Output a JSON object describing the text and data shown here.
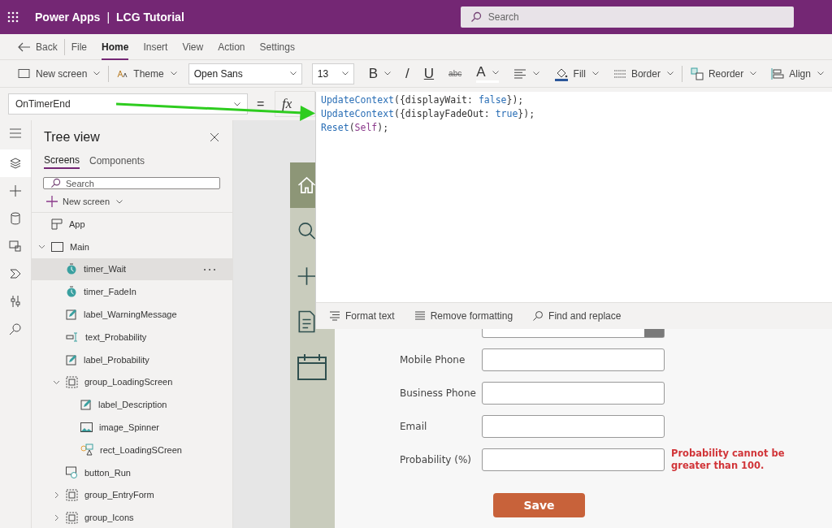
{
  "header": {
    "app_name": "Power Apps",
    "separator": "|",
    "app_title": "LCG Tutorial",
    "search": {
      "placeholder": "Search"
    }
  },
  "menu": {
    "back": "Back",
    "items": [
      {
        "label": "File",
        "selected": false
      },
      {
        "label": "Home",
        "selected": true
      },
      {
        "label": "Insert",
        "selected": false
      },
      {
        "label": "View",
        "selected": false
      },
      {
        "label": "Action",
        "selected": false
      },
      {
        "label": "Settings",
        "selected": false
      }
    ]
  },
  "toolbar": {
    "new_screen": "New screen",
    "theme": "Theme",
    "font": "Open Sans",
    "font_size": "13",
    "bold": "B",
    "italic": "/",
    "underline": "U",
    "strikethrough": "abc",
    "font_color": "A",
    "fill": "Fill",
    "border": "Border",
    "reorder": "Reorder",
    "align": "Align"
  },
  "formula_bar": {
    "property": "OnTimerEnd",
    "equals": "=",
    "fx": "fx",
    "code": [
      [
        {
          "text": "UpdateContext",
          "kind": "function"
        },
        {
          "text": "({displayWait: ",
          "kind": "plain"
        },
        {
          "text": "false",
          "kind": "literal"
        },
        {
          "text": "});",
          "kind": "plain"
        }
      ],
      [
        {
          "text": "UpdateContext",
          "kind": "function"
        },
        {
          "text": "({displayFadeOut: ",
          "kind": "plain"
        },
        {
          "text": "true",
          "kind": "literal"
        },
        {
          "text": "});",
          "kind": "plain"
        }
      ],
      [
        {
          "text": "Reset",
          "kind": "function"
        },
        {
          "text": "(",
          "kind": "plain"
        },
        {
          "text": "Self",
          "kind": "keyword"
        },
        {
          "text": ");",
          "kind": "plain"
        }
      ]
    ],
    "actions": [
      "Format text",
      "Remove formatting",
      "Find and replace"
    ]
  },
  "rail": [
    {
      "selected": true
    },
    {
      "selected": false
    },
    {
      "selected": false
    },
    {
      "selected": false
    },
    {
      "selected": false
    },
    {
      "selected": false
    },
    {
      "selected": false
    }
  ],
  "tree": {
    "title": "Tree view",
    "tabs": [
      {
        "label": "Screens",
        "selected": true
      },
      {
        "label": "Components",
        "selected": false
      }
    ],
    "search": {
      "placeholder": "Search"
    },
    "new_screen": "New screen",
    "items": [
      {
        "label": "App",
        "kind": "app",
        "selected": false
      },
      {
        "label": "Main",
        "kind": "screen",
        "selected": false,
        "expanded": true,
        "children": [
          {
            "label": "timer_Wait",
            "kind": "timer",
            "selected": true
          },
          {
            "label": "timer_FadeIn",
            "kind": "timer",
            "selected": false
          },
          {
            "label": "label_WarningMessage",
            "kind": "label",
            "selected": false
          },
          {
            "label": "text_Probability",
            "kind": "text_input",
            "selected": false
          },
          {
            "label": "label_Probability",
            "kind": "label",
            "selected": false
          },
          {
            "label": "group_LoadingScreen",
            "kind": "group",
            "selected": false,
            "expanded": true,
            "children": [
              {
                "label": "label_Description",
                "kind": "label",
                "selected": false
              },
              {
                "label": "image_Spinner",
                "kind": "image",
                "selected": false
              },
              {
                "label": "rect_LoadingSCreen",
                "kind": "shape",
                "selected": false
              }
            ]
          },
          {
            "label": "button_Run",
            "kind": "button",
            "selected": false
          },
          {
            "label": "group_EntryForm",
            "kind": "group",
            "selected": false,
            "expanded": false
          },
          {
            "label": "group_Icons",
            "kind": "group",
            "selected": false,
            "expanded": false
          }
        ]
      }
    ]
  },
  "app_screen": {
    "nav": [
      {
        "selected": true
      },
      {
        "selected": false
      },
      {
        "selected": false
      },
      {
        "selected": false
      },
      {
        "selected": false
      }
    ],
    "fields": [
      {
        "kind": "dropdown"
      },
      {
        "kind": "text",
        "label": "Mobile Phone"
      },
      {
        "kind": "text",
        "label": "Business Phone"
      },
      {
        "kind": "text",
        "label": "Email"
      },
      {
        "kind": "text",
        "label": "Probability (%)",
        "error": "Probability cannot be greater than 100."
      }
    ],
    "save_button": "Save"
  }
}
